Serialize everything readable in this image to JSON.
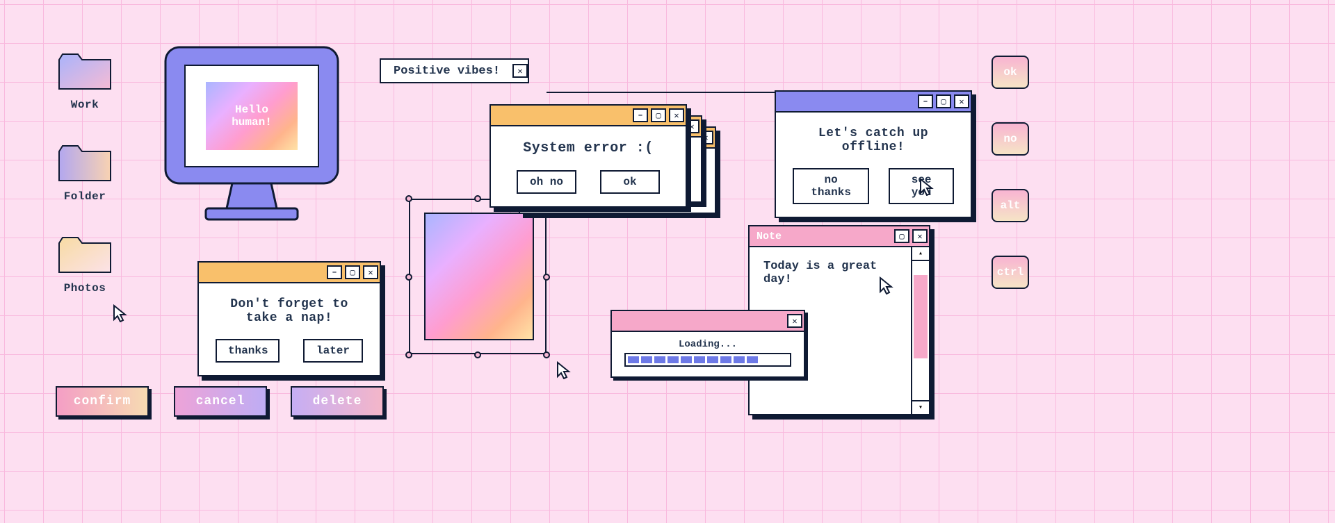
{
  "folders": {
    "work": "Work",
    "folder": "Folder",
    "photos": "Photos"
  },
  "monitor_text": "Hello\nhuman!",
  "positive_vibes": "Positive vibes!",
  "nap_dialog": {
    "message": "Don't forget to take a nap!",
    "thanks": "thanks",
    "later": "later"
  },
  "error_dialog": {
    "message": "System error :(",
    "ohno": "oh no",
    "ok": "ok"
  },
  "catchup_dialog": {
    "message": "Let's catch up offline!",
    "no_thanks": "no thanks",
    "see_you": "see you"
  },
  "note": {
    "title": "Note",
    "text": "Today is a great day!"
  },
  "loading": {
    "label": "Loading...",
    "segments": 10
  },
  "g_buttons": {
    "confirm": "confirm",
    "cancel": "cancel",
    "delete": "delete"
  },
  "s_buttons": {
    "ok": "ok",
    "no": "no",
    "alt": "alt",
    "ctrl": "ctrl"
  }
}
